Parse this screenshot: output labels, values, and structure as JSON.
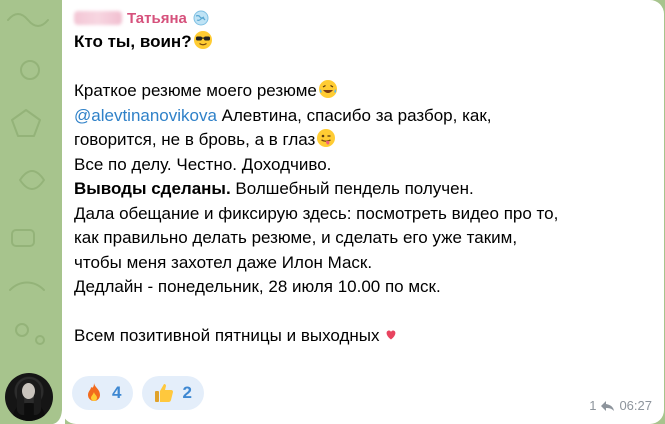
{
  "sender": {
    "name": "Татьяна"
  },
  "message": {
    "line1_bold": "Кто ты, воин?",
    "line2": "Краткое резюме моего резюме",
    "mention": "@alevtinanovikova",
    "line3_rest": " Алевтина, спасибо за разбор, как,",
    "line4": "говорится, не в бровь, а в глаз",
    "line5": "Все по делу. Честно. Доходчиво.",
    "line6_bold": "Выводы сделаны.",
    "line6_rest": " Волшебный пендель получен.",
    "line7": "Дала обещание и фиксирую здесь: посмотреть видео про то,",
    "line8": "как правильно делать резюме, и сделать его уже таким,",
    "line9": "чтобы меня захотел даже Илон Маск.",
    "line10": "Дедлайн - понедельник, 28 июля 10.00 по мск.",
    "line11": "Всем позитивной пятницы и выходных"
  },
  "reactions": [
    {
      "emoji": "fire-icon",
      "count": "4"
    },
    {
      "emoji": "thumbs-up-icon",
      "count": "2"
    }
  ],
  "meta": {
    "reply_count": "1",
    "time": "06:27"
  },
  "colors": {
    "background": "#a7c48d",
    "sender_name": "#d6517c",
    "mention": "#2f81c8",
    "reaction_bg": "#e4eefa",
    "reaction_count": "#3e88d2",
    "meta": "#8d949c"
  }
}
